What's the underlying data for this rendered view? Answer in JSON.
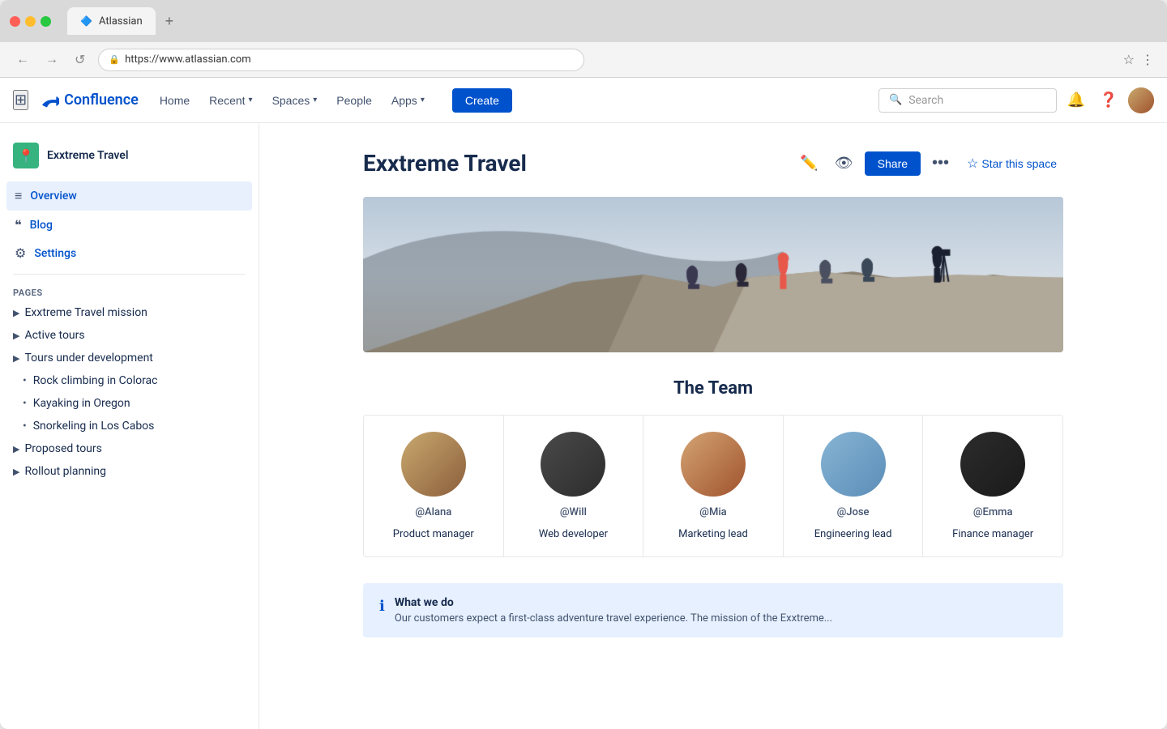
{
  "browser": {
    "tab_title": "Atlassian",
    "address": "https://www.atlassian.com",
    "tab_plus": "+",
    "nav_back": "←",
    "nav_forward": "→",
    "nav_reload": "↺",
    "star_icon": "☆",
    "more_icon": "⋮"
  },
  "nav": {
    "logo_text": "Confluence",
    "home": "Home",
    "recent": "Recent",
    "spaces": "Spaces",
    "people": "People",
    "apps": "Apps",
    "create": "Create",
    "search_placeholder": "Search"
  },
  "sidebar": {
    "space_name": "Exxtreme Travel",
    "space_icon": "📍",
    "nav_items": [
      {
        "id": "overview",
        "label": "Overview",
        "icon": "≡",
        "active": true
      },
      {
        "id": "blog",
        "label": "Blog",
        "icon": "❝"
      },
      {
        "id": "settings",
        "label": "Settings",
        "icon": "⚙"
      }
    ],
    "pages_label": "PAGES",
    "pages": [
      {
        "id": "mission",
        "label": "Exxtreme Travel mission",
        "level": 0,
        "has_children": true
      },
      {
        "id": "active-tours",
        "label": "Active tours",
        "level": 0,
        "has_children": true
      },
      {
        "id": "tours-dev",
        "label": "Tours under development",
        "level": 0,
        "has_children": true
      },
      {
        "id": "rock-climbing",
        "label": "Rock climbing in Colorac",
        "level": 1,
        "has_children": false
      },
      {
        "id": "kayaking",
        "label": "Kayaking in Oregon",
        "level": 1,
        "has_children": false
      },
      {
        "id": "snorkeling",
        "label": "Snorkeling in Los Cabos",
        "level": 1,
        "has_children": false
      },
      {
        "id": "proposed",
        "label": "Proposed tours",
        "level": 0,
        "has_children": true
      },
      {
        "id": "rollout",
        "label": "Rollout planning",
        "level": 0,
        "has_children": true
      }
    ]
  },
  "page": {
    "title": "Exxtreme Travel",
    "share_label": "Share",
    "star_label": "Star this space",
    "more_icon": "•••",
    "edit_icon": "✏",
    "view_icon": "👁",
    "star_icon": "☆"
  },
  "team_section": {
    "title": "The Team",
    "members": [
      {
        "id": "alana",
        "handle": "@Alana",
        "role": "Product manager",
        "color": "av-alana"
      },
      {
        "id": "will",
        "handle": "@Will",
        "role": "Web developer",
        "color": "av-will"
      },
      {
        "id": "mia",
        "handle": "@Mia",
        "role": "Marketing lead",
        "color": "av-mia"
      },
      {
        "id": "jose",
        "handle": "@Jose",
        "role": "Engineering lead",
        "color": "av-jose"
      },
      {
        "id": "emma",
        "handle": "@Emma",
        "role": "Finance manager",
        "color": "av-emma"
      }
    ]
  },
  "info_box": {
    "icon": "ℹ",
    "title": "What we do",
    "text": "Our customers expect a first-class adventure travel experience. The mission of the Exxtreme..."
  },
  "colors": {
    "primary": "#0052cc",
    "text_dark": "#172b4d",
    "text_mid": "#42526e",
    "bg_light": "#f4f5f7",
    "info_bg": "#e6f0ff"
  }
}
